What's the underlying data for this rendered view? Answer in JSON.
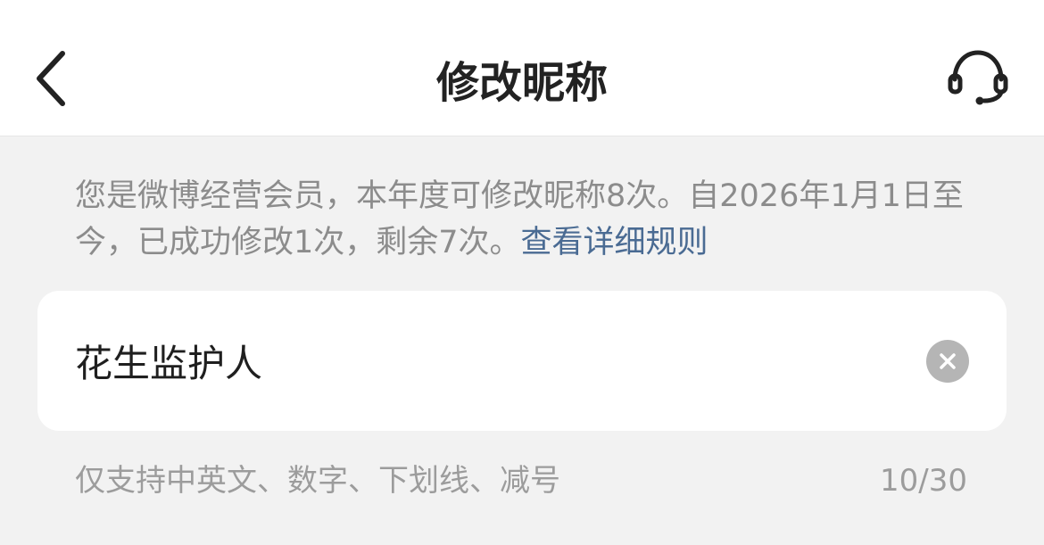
{
  "header": {
    "title": "修改昵称",
    "back_icon": "chevron-left-icon",
    "support_icon": "headset-icon"
  },
  "notice": {
    "text": "您是微博经营会员，本年度可修改昵称8次。自2026年1月1日至今，已成功修改1次，剩余7次。",
    "link_label": "查看详细规则",
    "link_color": "#4a6b93"
  },
  "nickname": {
    "value": "花生监护人",
    "clear_icon": "clear-circle-icon"
  },
  "footer": {
    "hint": "仅支持中英文、数字、下划线、减号",
    "counter": "10/30"
  },
  "colors": {
    "background": "#f2f2f2",
    "card": "#ffffff",
    "muted_text": "#8c8c8c",
    "primary_text": "#1f1f1f"
  }
}
